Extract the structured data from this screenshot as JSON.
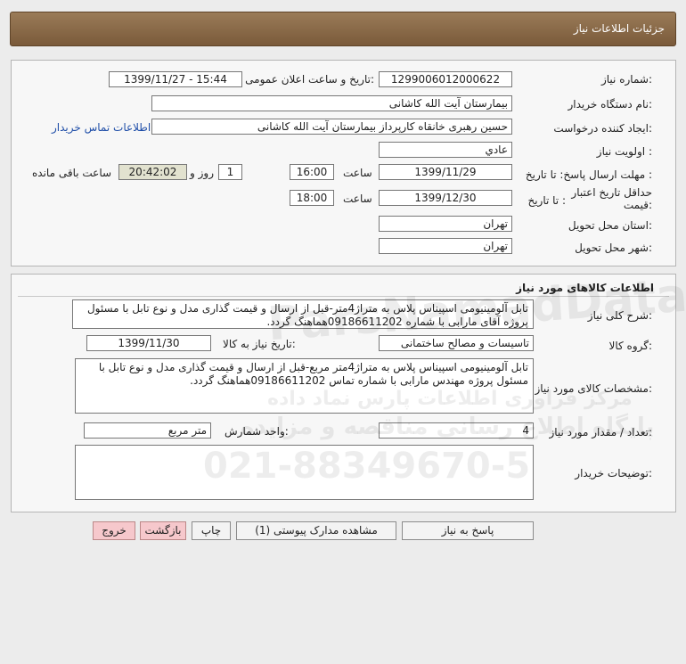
{
  "header": {
    "title": "جزئیات اطلاعات نیاز"
  },
  "info": {
    "need_number_label": "شماره نیاز:",
    "need_number": "1299006012000622",
    "announce_label": "تاریخ و ساعت اعلان عمومی:",
    "announce_value": "1399/11/27 - 15:44",
    "buyer_org_label": "نام دستگاه خریدار:",
    "buyer_org": "بیمارستان آیت الله کاشانی",
    "creator_label": "ایجاد کننده درخواست:",
    "creator": "حسین رهبری خانقاه کارپرداز بیمارستان آیت الله کاشانی",
    "contact_link": "اطلاعات تماس خریدار",
    "priority_label": "اولویت نیاز :",
    "priority": "عادي",
    "deadline_label": "مهلت ارسال پاسخ:  تا تاریخ :",
    "deadline_date": "1399/11/29",
    "time_label": "ساعت",
    "deadline_time": "16:00",
    "days_value": "1",
    "days_label": "روز و",
    "remaining_time": "20:42:02",
    "remaining_label": "ساعت باقی مانده",
    "price_valid_label_1": "حداقل تاریخ اعتبار",
    "price_valid_label_2": "قیمت:",
    "until_date_label": "تا تاریخ :",
    "price_valid_date": "1399/12/30",
    "price_valid_time": "18:00",
    "province_label": "استان محل تحویل:",
    "province": "تهران",
    "city_label": "شهر محل تحویل:",
    "city": "تهران"
  },
  "goods": {
    "section_title": "اطلاعات کالاهای مورد نیاز",
    "general_desc_label": "شرح کلی نیاز:",
    "general_desc": "تابل آلومینیومی اسپیناس پلاس به متراژ4متر-قبل از ارسال و قیمت گذاری مدل و نوع تابل با مسئول پروژه آقای مارابی با شماره 09186611202هماهنگ گردد.",
    "group_label": "گروه کالا:",
    "group": "تاسیسات و مصالح ساختمانی",
    "need_date_label": "تاریخ نیاز به کالا:",
    "need_date": "1399/11/30",
    "specs_label": "مشخصات کالای مورد نیاز:",
    "specs": "تابل آلومینیومی اسپیناس پلاس به متراژ4متر مربع-قبل از ارسال و قیمت گذاری مدل و نوع تابل با مسئول پروژه مهندس مارابی با شماره تماس 09186611202هماهنگ گردد.",
    "qty_label": "تعداد / مقدار مورد نیاز:",
    "qty": "4",
    "unit_label": "واحد شمارش:",
    "unit": "متر مربع",
    "buyer_notes_label": "توضیحات خریدار:",
    "buyer_notes": ""
  },
  "buttons": {
    "reply": "پاسخ به نیاز",
    "attachments": "مشاهده مدارک پیوستی (1)",
    "print": "چاپ",
    "back": "بازگشت",
    "exit": "خروج"
  },
  "watermark": {
    "brand": "ParsNamadData",
    "line1": "مرکز فراوری اطلاعات پارس نماد داده",
    "line2": "پایگاه اطلاع رسانی مناقصه و مزایده",
    "phone": "021-88349670-5"
  }
}
